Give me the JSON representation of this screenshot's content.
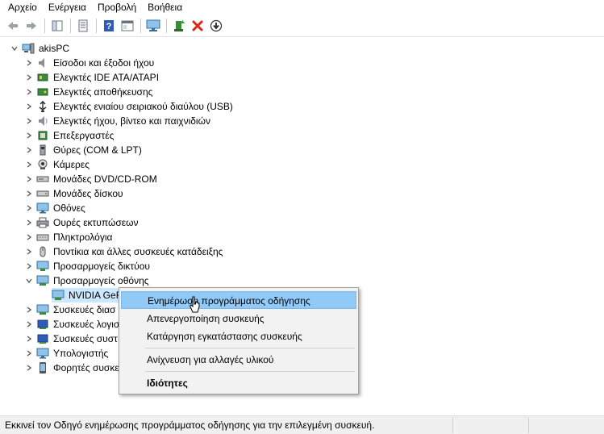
{
  "menu": [
    "Αρχείο",
    "Ενέργεια",
    "Προβολή",
    "Βοήθεια"
  ],
  "toolbar": {
    "buttons": [
      "back-arrow-icon",
      "forward-arrow-icon",
      "show-hide-tree-icon",
      "properties-icon",
      "help-icon",
      "panel-icon",
      "monitor-scan-icon",
      "update-driver-icon",
      "uninstall-x-icon",
      "download-icon"
    ]
  },
  "tree": {
    "root": "akisPC",
    "categories": [
      {
        "label": "Είσοδοι και έξοδοι ήχου",
        "icon": "speaker-icon"
      },
      {
        "label": "Ελεγκτές IDE ATA/ATAPI",
        "icon": "controller-icon"
      },
      {
        "label": "Ελεγκτές αποθήκευσης",
        "icon": "storage-icon"
      },
      {
        "label": "Ελεγκτές ενιαίου σειριακού διαύλου (USB)",
        "icon": "usb-icon"
      },
      {
        "label": "Ελεγκτές ήχου, βίντεο και παιχνιδιών",
        "icon": "audio-icon"
      },
      {
        "label": "Επεξεργαστές",
        "icon": "cpu-icon"
      },
      {
        "label": "Θύρες (COM & LPT)",
        "icon": "port-icon"
      },
      {
        "label": "Κάμερες",
        "icon": "camera-icon"
      },
      {
        "label": "Μονάδες DVD/CD-ROM",
        "icon": "dvd-icon"
      },
      {
        "label": "Μονάδες δίσκου",
        "icon": "disk-icon"
      },
      {
        "label": "Οθόνες",
        "icon": "monitor-icon"
      },
      {
        "label": "Ουρές εκτυπώσεων",
        "icon": "printer-icon"
      },
      {
        "label": "Πληκτρολόγια",
        "icon": "keyboard-icon"
      },
      {
        "label": "Ποντίκια και άλλες συσκευές κατάδειξης",
        "icon": "mouse-icon"
      },
      {
        "label": "Προσαρμογείς δικτύου",
        "icon": "network-icon"
      },
      {
        "label": "Προσαρμογείς οθόνης",
        "icon": "display-adapter-icon",
        "expanded": true
      },
      {
        "label": "Συσκευές διασ",
        "icon": "device-icon"
      },
      {
        "label": "Συσκευές λογισ",
        "icon": "software-device-icon"
      },
      {
        "label": "Συσκευές συστ",
        "icon": "system-device-icon"
      },
      {
        "label": "Υπολογιστής",
        "icon": "computer-icon"
      },
      {
        "label": "Φορητές συσκε",
        "icon": "portable-icon"
      }
    ],
    "child": "NVIDIA GeF"
  },
  "context_menu": {
    "update_driver": "Ενημέρωση προγράμματος οδήγησης",
    "disable": "Απενεργοποίηση συσκευής",
    "uninstall": "Κατάργηση εγκατάστασης συσκευής",
    "scan": "Ανίχνευση για αλλαγές υλικού",
    "properties": "Ιδιότητες"
  },
  "status": "Εκκινεί τον Οδηγό ενημέρωσης προγράμματος οδήγησης για την επιλεγμένη συσκευή.",
  "colors": {
    "highlight": "#91c9f7",
    "menu_bg": "#f2f2f2",
    "accent": "#1e90d6"
  }
}
